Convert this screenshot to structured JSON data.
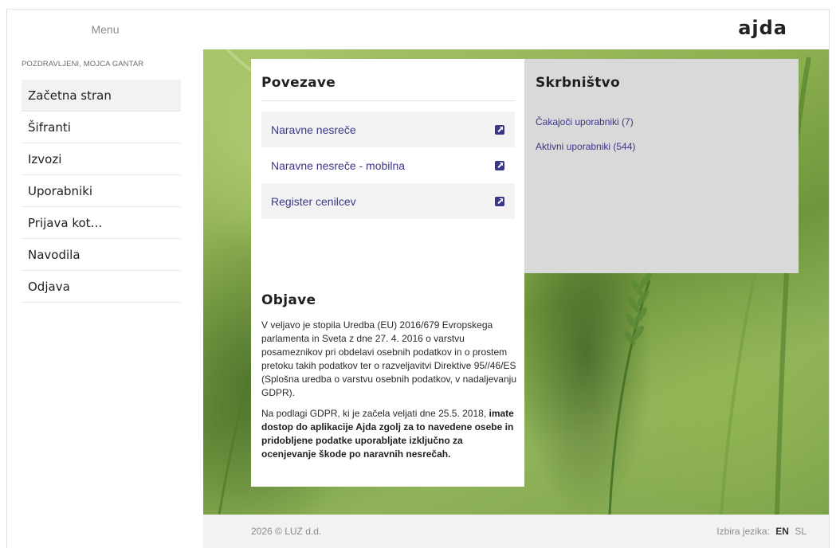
{
  "header": {
    "menu_label": "Menu",
    "logo_text": "ajda"
  },
  "sidebar": {
    "greeting": "POZDRAVLJENI, MOJCA GANTAR",
    "items": [
      {
        "label": "Začetna stran"
      },
      {
        "label": "Šifranti"
      },
      {
        "label": "Izvozi"
      },
      {
        "label": "Uporabniki"
      },
      {
        "label": "Prijava kot…"
      },
      {
        "label": "Navodila"
      },
      {
        "label": "Odjava"
      }
    ]
  },
  "povezave": {
    "title": "Povezave",
    "links": [
      {
        "label": "Naravne nesreče",
        "icon": "external-link-icon"
      },
      {
        "label": "Naravne nesreče - mobilna",
        "icon": "external-link-icon"
      },
      {
        "label": "Register cenilcev",
        "icon": "external-link-icon"
      }
    ]
  },
  "skrbnistvo": {
    "title": "Skrbništvo",
    "links": [
      {
        "label": "Čakajoči uporabniki (7)"
      },
      {
        "label": "Aktivni uporabniki (544)"
      }
    ]
  },
  "objave": {
    "title": "Objave",
    "paragraph1": "V veljavo je stopila Uredba (EU) 2016/679 Evropskega parlamenta in Sveta z dne 27. 4. 2016 o varstvu posameznikov pri obdelavi osebnih podatkov in o prostem pretoku takih podatkov ter o razveljavitvi Direktive 95//46/ES (Splošna uredba o varstvu osebnih podatkov, v nadaljevanju GDPR).",
    "paragraph2_prefix": "Na podlagi GDPR, ki je začela veljati dne 25.5. 2018, ",
    "paragraph2_bold": "imate dostop do aplikacije Ajda zgolj za to navedene osebe in pridobljene podatke uporabljate izključno za ocenjevanje škode po naravnih nesrečah."
  },
  "footer": {
    "copyright": "2026 © LUZ d.d.",
    "language_label": "Izbira jezika:",
    "lang_en": "EN",
    "lang_sl": "SL"
  },
  "colors": {
    "accent": "#3a3788",
    "right_panel_bg": "#d9d9d9"
  }
}
